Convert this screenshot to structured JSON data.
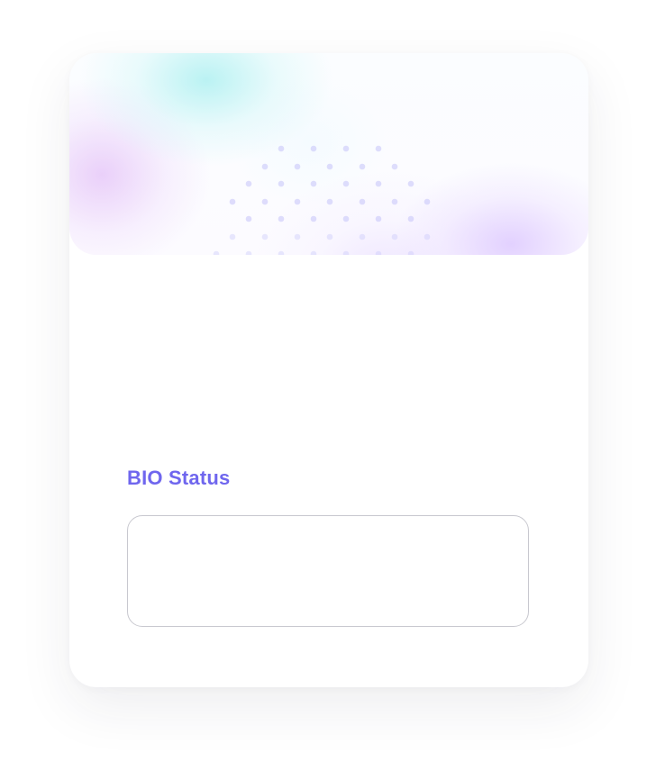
{
  "card": {
    "title": "BIO Status",
    "title_color": "#6F66EE",
    "status_value": "",
    "placeholder": ""
  },
  "banner": {
    "background_colors": [
      "#A1EEEE",
      "#DDB0F5",
      "#DBC5FF",
      "#E5D6FF"
    ],
    "dot_color": "#C6C4FA",
    "decorative_icon_name": "dot-grid-icon"
  }
}
